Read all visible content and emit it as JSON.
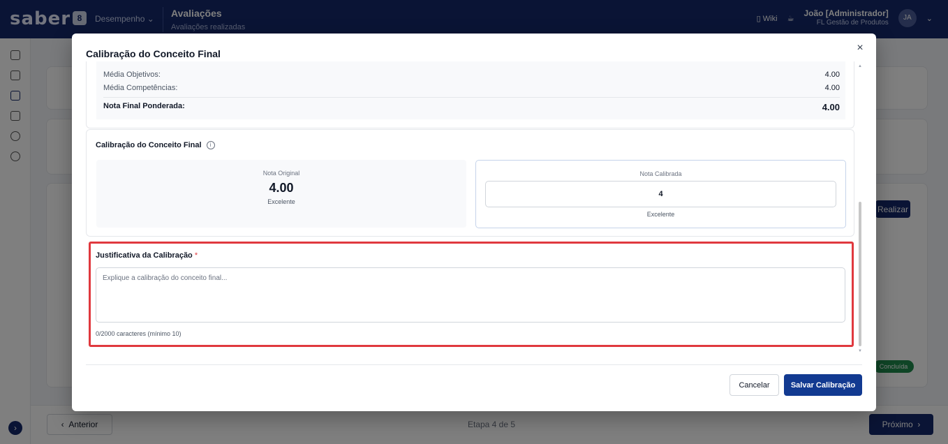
{
  "app": {
    "logo": "saber",
    "logo_badge": "8",
    "module": "Desempenho ⌄",
    "page_title": "Avaliações",
    "page_subtitle": "Avaliações realizadas",
    "wiki": "Wiki",
    "user_name": "João [Administrador]",
    "user_role": "FL Gestão de Produtos",
    "user_initials": "JA"
  },
  "background": {
    "realizar_button": "Realizar",
    "status_badge": "Concluída",
    "prev_button": "Anterior",
    "step_indicator": "Etapa 4 de 5",
    "next_button": "Próximo"
  },
  "modal": {
    "title": "Calibração do Conceito Final",
    "close_icon": "×",
    "summary": {
      "media_objetivos_label": "Média Objetivos:",
      "media_objetivos_value": "4.00",
      "media_competencias_label": "Média Competências:",
      "media_competencias_value": "4.00",
      "nota_final_label": "Nota Final Ponderada:",
      "nota_final_value": "4.00"
    },
    "calibration": {
      "title": "Calibração do Conceito Final",
      "info_icon": "i",
      "original_label": "Nota Original",
      "original_value": "4.00",
      "original_concept": "Excelente",
      "calibrated_label": "Nota Calibrada",
      "calibrated_value": "4",
      "calibrated_concept": "Excelente"
    },
    "justification": {
      "title": "Justificativa da Calibração",
      "required_mark": "*",
      "placeholder": "Explique a calibração do conceito final...",
      "value": "",
      "counter": "0/2000 caracteres (mínimo 10)"
    },
    "footer": {
      "cancel_label": "Cancelar",
      "save_label": "Salvar Calibração"
    }
  },
  "colors": {
    "topbar": "#14296a",
    "primary_button": "#123a91",
    "highlight_border": "#e0393e"
  }
}
